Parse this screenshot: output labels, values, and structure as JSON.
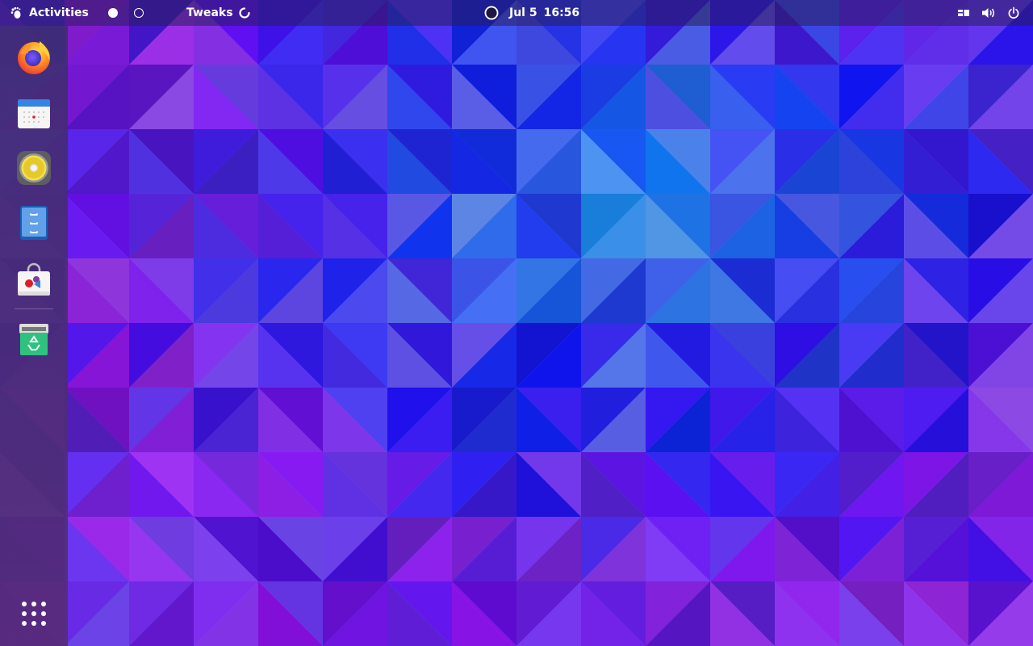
{
  "topbar": {
    "activities_label": "Activities",
    "app_name": "Tweaks",
    "date": "Jul 5",
    "time": "16:56",
    "workspaces": [
      "active",
      "inactive"
    ]
  },
  "dock": {
    "apps": [
      {
        "name": "Firefox",
        "icon": "firefox-icon"
      },
      {
        "name": "Calendar",
        "icon": "calendar-icon"
      },
      {
        "name": "Rhythmbox",
        "icon": "speaker-icon"
      },
      {
        "name": "Files",
        "icon": "file-cabinet-icon"
      },
      {
        "name": "Software",
        "icon": "shopping-bag-icon"
      },
      {
        "name": "Trash",
        "icon": "recycle-bin-icon"
      }
    ],
    "show_apps_icon": "grid-dots-icon"
  },
  "tray": {
    "icons": [
      "window-switcher-icon",
      "volume-icon",
      "power-icon"
    ]
  },
  "colors": {
    "topbar": "#281e5a",
    "dock": "#3c2d6e",
    "wallpaper_blue": "#3b8dff",
    "wallpaper_purple": "#7a34d6"
  }
}
